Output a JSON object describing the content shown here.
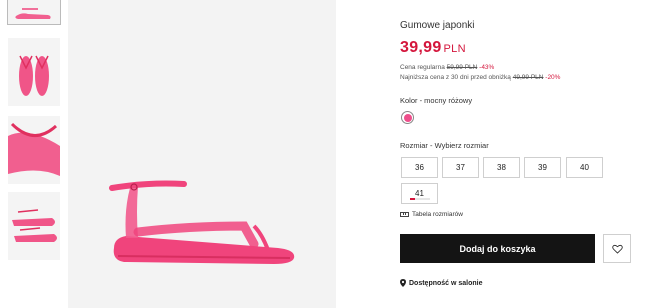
{
  "product": {
    "title": "Gumowe japonki",
    "price": "39,99",
    "currency": "PLN",
    "regular_label": "Cena regularna",
    "regular_price": "59,99 PLN",
    "regular_discount": "-43%",
    "lowest_label": "Najniższa cena z 30 dni przed obniżką",
    "lowest_price": "49,99 PLN",
    "lowest_discount": "-20%"
  },
  "color": {
    "label": "Kolor - mocny różowy",
    "swatch_hex": "#ee4e8b"
  },
  "sizes": {
    "label": "Rozmiar  - Wybierz rozmiar",
    "options": [
      "36",
      "37",
      "38",
      "39",
      "40",
      "41"
    ],
    "low_stock_size": "41"
  },
  "size_chart": {
    "label": "Tabela rozmiarów",
    "icon": "ruler-icon"
  },
  "actions": {
    "add_to_cart": "Dodaj do koszyka",
    "wishlist_icon": "heart-icon",
    "store_availability": "Dostępność w salonie",
    "store_icon": "location-pin-icon"
  },
  "colors": {
    "accent": "#d4163c",
    "button": "#141414",
    "product_pink": "#f0447c"
  }
}
